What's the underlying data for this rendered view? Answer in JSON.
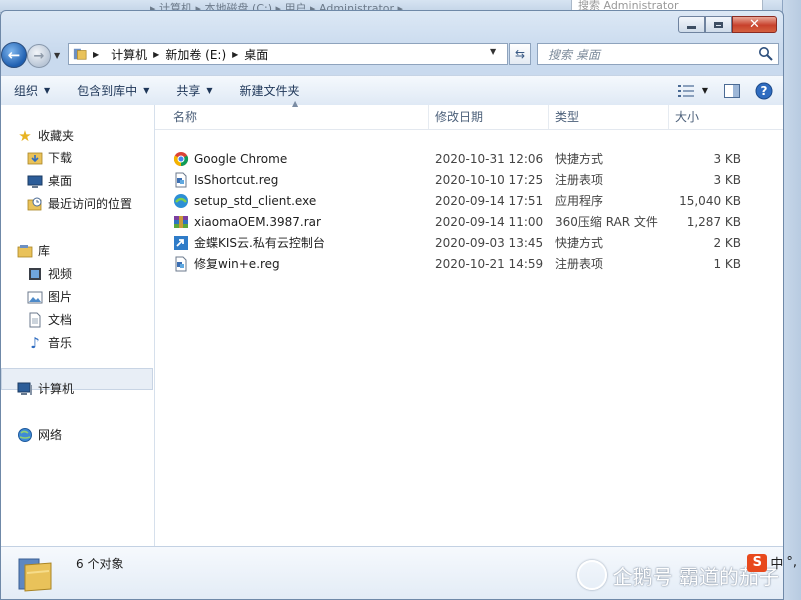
{
  "window": {
    "address": [
      "计算机",
      "新加卷 (E:)",
      "桌面"
    ],
    "search_placeholder": "搜索 桌面"
  },
  "background_window": {
    "breadcrumb_ghost": "▸ 计算机 ▸ 本地磁盘 (C:) ▸ 用户 ▸ Administrator ▸",
    "search_ghost": "搜索 Administrator"
  },
  "toolbar": {
    "organize": "组织",
    "include_in_library": "包含到库中",
    "share": "共享",
    "new_folder": "新建文件夹"
  },
  "nav_pane": {
    "favorites": "收藏夹",
    "downloads": "下载",
    "desktop": "桌面",
    "recent": "最近访问的位置",
    "libraries": "库",
    "videos": "视频",
    "pictures": "图片",
    "documents": "文档",
    "music": "音乐",
    "computer": "计算机",
    "network": "网络"
  },
  "columns": [
    "名称",
    "修改日期",
    "类型",
    "大小"
  ],
  "files": [
    {
      "name": "Google Chrome",
      "date": "2020-10-31 12:06",
      "type": "快捷方式",
      "size": "3 KB",
      "icon": "chrome-icon"
    },
    {
      "name": "IsShortcut.reg",
      "date": "2020-10-10 17:25",
      "type": "注册表项",
      "size": "3 KB",
      "icon": "reg-file-icon"
    },
    {
      "name": "setup_std_client.exe",
      "date": "2020-09-14 17:51",
      "type": "应用程序",
      "size": "15,040 KB",
      "icon": "exe-setup-icon"
    },
    {
      "name": "xiaomaOEM.3987.rar",
      "date": "2020-09-14 11:00",
      "type": "360压缩 RAR 文件",
      "size": "1,287 KB",
      "icon": "rar-archive-icon"
    },
    {
      "name": "金蝶KIS云.私有云控制台",
      "date": "2020-09-03 13:45",
      "type": "快捷方式",
      "size": "2 KB",
      "icon": "shortcut-icon"
    },
    {
      "name": "修复win+e.reg",
      "date": "2020-10-21 14:59",
      "type": "注册表项",
      "size": "1 KB",
      "icon": "reg-file-icon"
    }
  ],
  "status": {
    "count": "6 个对象"
  },
  "watermark": {
    "text": "企鹅号 霸道的茄子"
  },
  "ime": {
    "logo": "S",
    "mode": "中",
    "punct": "°,"
  }
}
